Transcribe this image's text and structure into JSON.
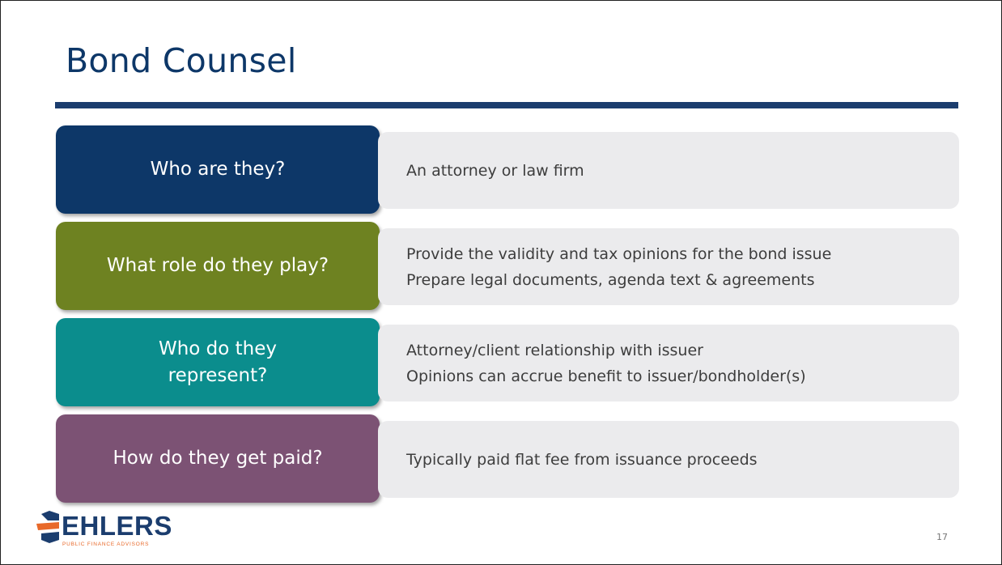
{
  "slide": {
    "title": "Bond Counsel",
    "page_number": "17"
  },
  "rows": [
    {
      "label": "Who are they?",
      "lines": [
        "An attorney or law firm"
      ]
    },
    {
      "label": "What role do they play?",
      "lines": [
        "Provide the validity and tax opinions for the bond issue",
        "Prepare legal documents, agenda text & agreements"
      ]
    },
    {
      "label": "Who do they represent?",
      "lines": [
        "Attorney/client relationship with issuer",
        "Opinions can accrue benefit to issuer/bondholder(s)"
      ]
    },
    {
      "label": "How do they get paid?",
      "lines": [
        "Typically paid flat fee from issuance proceeds"
      ]
    }
  ],
  "logo": {
    "name": "EHLERS",
    "tagline": "PUBLIC FINANCE ADVISORS"
  },
  "colors": {
    "title": "#0d3768",
    "rule": "#1b3d6e",
    "row_1": "#0d3768",
    "row_2": "#6e8221",
    "row_3": "#0b8d8d",
    "row_4": "#7c5274",
    "desc_bg": "#ebebed",
    "logo_accent": "#e8692a"
  }
}
